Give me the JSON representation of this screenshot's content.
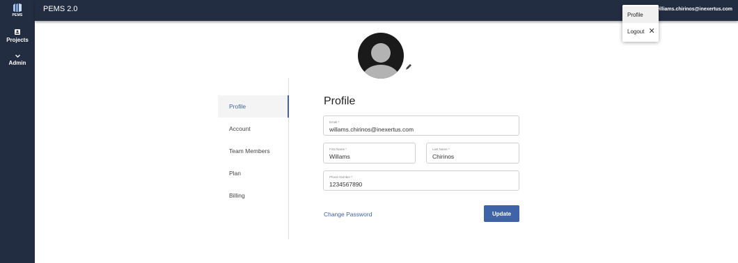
{
  "app": {
    "logo_text": "PEMS",
    "title": "PEMS 2.0"
  },
  "sidebar": {
    "items": [
      {
        "label": "Projects",
        "icon": "projects-icon"
      },
      {
        "label": "Admin",
        "icon": "chevron-down-icon"
      }
    ]
  },
  "header": {
    "user_email": "williams.chirinos@inexertus.com"
  },
  "user_menu": {
    "profile_label": "Profile",
    "logout_label": "Logout"
  },
  "tabs": [
    {
      "label": "Profile",
      "active": true
    },
    {
      "label": "Account",
      "active": false
    },
    {
      "label": "Team Members",
      "active": false
    },
    {
      "label": "Plan",
      "active": false
    },
    {
      "label": "Billing",
      "active": false
    }
  ],
  "form": {
    "heading": "Profile",
    "email": {
      "label": "Email *",
      "value": "willams.chirinos@inexertus.com"
    },
    "first_name": {
      "label": "First Name *",
      "value": "Willams"
    },
    "last_name": {
      "label": "Last Name *",
      "value": "Chirinos"
    },
    "phone": {
      "label": "Phone Number *",
      "value": "1234567890"
    },
    "change_password_label": "Change Password",
    "update_label": "Update"
  },
  "colors": {
    "sidebar_bg": "#232d41",
    "accent": "#3f63a7"
  }
}
